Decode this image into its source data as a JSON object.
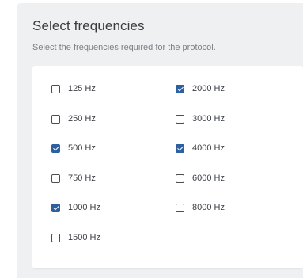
{
  "header": {
    "title": "Select frequencies",
    "subtitle": "Select the frequencies required for the protocol."
  },
  "colors": {
    "panel_background": "#eef0f2",
    "checkbox_checked": "#2e5f9e"
  },
  "frequencies": [
    {
      "label": "125 Hz",
      "checked": false
    },
    {
      "label": "2000 Hz",
      "checked": true
    },
    {
      "label": "250 Hz",
      "checked": false
    },
    {
      "label": "3000 Hz",
      "checked": false
    },
    {
      "label": "500 Hz",
      "checked": true
    },
    {
      "label": "4000 Hz",
      "checked": true
    },
    {
      "label": "750 Hz",
      "checked": false
    },
    {
      "label": "6000 Hz",
      "checked": false
    },
    {
      "label": "1000 Hz",
      "checked": true
    },
    {
      "label": "8000 Hz",
      "checked": false
    },
    {
      "label": "1500 Hz",
      "checked": false
    }
  ]
}
